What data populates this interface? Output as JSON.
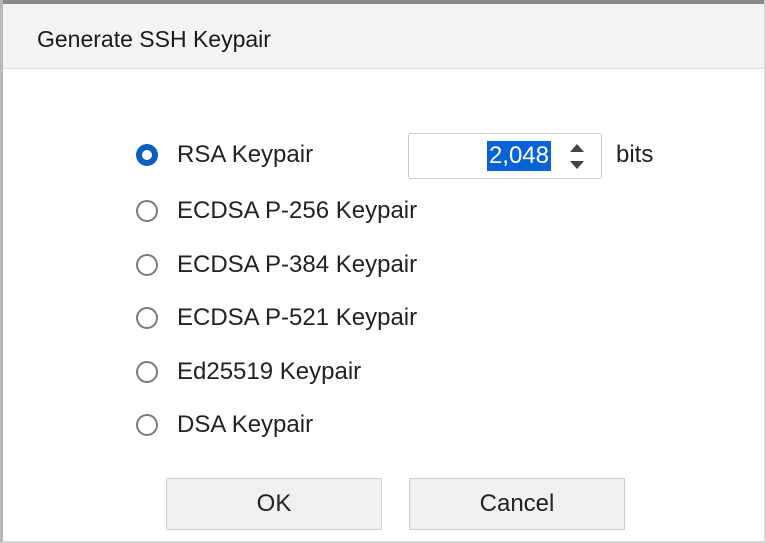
{
  "dialog": {
    "title": "Generate SSH Keypair"
  },
  "options": [
    {
      "label": "RSA Keypair",
      "checked": true
    },
    {
      "label": "ECDSA P-256 Keypair",
      "checked": false
    },
    {
      "label": "ECDSA P-384 Keypair",
      "checked": false
    },
    {
      "label": "ECDSA P-521 Keypair",
      "checked": false
    },
    {
      "label": "Ed25519 Keypair",
      "checked": false
    },
    {
      "label": "DSA Keypair",
      "checked": false
    }
  ],
  "rsa_bits": {
    "value": "2,048",
    "unit": "bits"
  },
  "buttons": {
    "ok": "OK",
    "cancel": "Cancel"
  },
  "colors": {
    "accent": "#0a5ec2",
    "selection": "#0a63d4",
    "titlebar": "#f3f3f3"
  },
  "icons": {
    "spin_up": "chevron-up-icon",
    "spin_down": "chevron-down-icon"
  }
}
